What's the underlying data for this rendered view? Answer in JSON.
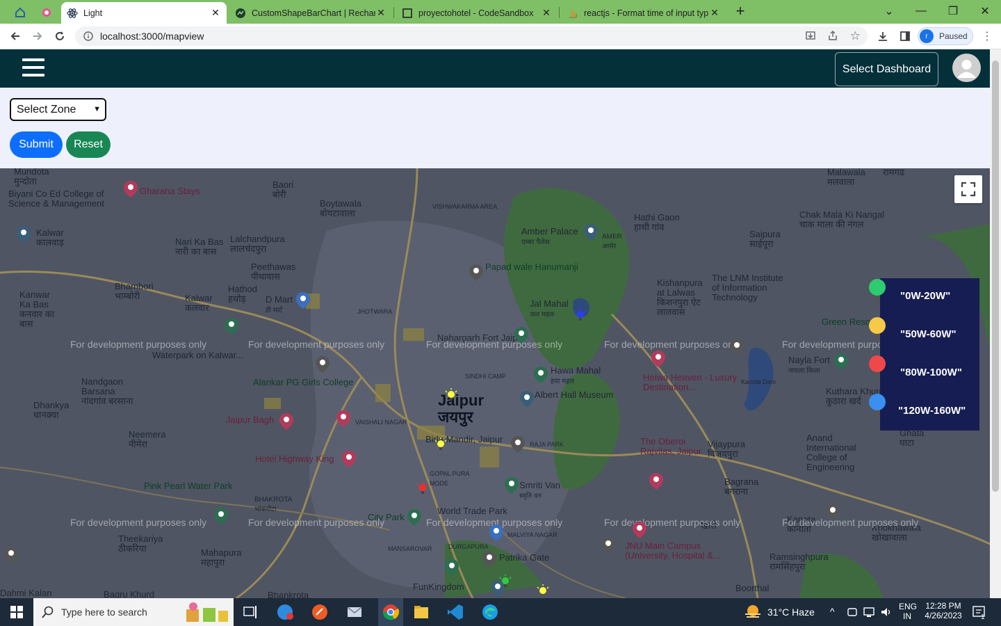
{
  "browser": {
    "tabs": [
      {
        "title": "Light",
        "active": true,
        "icon": "react-icon"
      },
      {
        "title": "CustomShapeBarChart | Recharts",
        "icon": "recharts-icon"
      },
      {
        "title": "proyectohotel - CodeSandbox",
        "icon": "codesandbox-icon"
      },
      {
        "title": "reactjs - Format time of input typ",
        "icon": "stackoverflow-icon"
      }
    ],
    "url": "localhost:3000/mapview",
    "profile_initial": "r",
    "profile_status": "Paused"
  },
  "app": {
    "dashboard_button": "Select Dashboard",
    "zone_select": {
      "selected": "Select Zone"
    },
    "submit_label": "Submit",
    "reset_label": "Reset"
  },
  "map": {
    "watermark": "For development purposes only",
    "city": {
      "en": "Jaipur",
      "hi": "जयपुर"
    },
    "places": [
      {
        "name": "Mundota",
        "local": "मुन्दोता"
      },
      {
        "name": "Biyani Co Ed College of Science & Management"
      },
      {
        "name": "Gharana Stays"
      },
      {
        "name": "Baori",
        "local": "बोरी"
      },
      {
        "name": "Boytawala",
        "local": "बोयटावाला"
      },
      {
        "name": "VISHWAKARMA AREA"
      },
      {
        "name": "Kalwar",
        "local": "कालवाड़"
      },
      {
        "name": "Nari Ka Bas",
        "local": "नारी का बास"
      },
      {
        "name": "Lalchandpura",
        "local": "लालचंदपुरा"
      },
      {
        "name": "Amber Palace",
        "local": "एम्बर पैलेस"
      },
      {
        "name": "AMER",
        "local": "आमेर"
      },
      {
        "name": "Hathi Gaon",
        "local": "हाथी गांव"
      },
      {
        "name": "Chak Mala Ki Nangal",
        "local": "चाक माला की नंगल"
      },
      {
        "name": "Saipura",
        "local": "साईपूरा"
      },
      {
        "name": "Malawala",
        "local": "मलवाला"
      },
      {
        "name": "Jamwa Ramgarh",
        "local": "रामगढ"
      },
      {
        "name": "Peethawas",
        "local": "पीथावास"
      },
      {
        "name": "Papad wale Hanumanji"
      },
      {
        "name": "Bhambori",
        "local": "भाम्बोरी"
      },
      {
        "name": "Hathod",
        "local": "हथोड़"
      },
      {
        "name": "D Mart",
        "local": "डी मार्ट"
      },
      {
        "name": "Kalwar",
        "local": "कलवार"
      },
      {
        "name": "Kanwar Ka Bas",
        "local": "कनवार का बास"
      },
      {
        "name": "Jal Mahal",
        "local": "जल महल"
      },
      {
        "name": "Kishanpura at Lalwas",
        "local": "किशनपुरा ऐट लालवास"
      },
      {
        "name": "The LNM Institute of Information Technology"
      },
      {
        "name": "Green Resort"
      },
      {
        "name": "JHOTWARA"
      },
      {
        "name": "Nahargarh Fort Jaipur"
      },
      {
        "name": "Nayla Fort",
        "local": "नायला किला"
      },
      {
        "name": "Waterpark on Kalwar..."
      },
      {
        "name": "Hawa Mahal",
        "local": "हवा महल"
      },
      {
        "name": "SINDHI CAMP"
      },
      {
        "name": "Heiwa Heaven - Luxury Destination..."
      },
      {
        "name": "Kanota Dam"
      },
      {
        "name": "Nandgaon Barsana",
        "local": "नांदगांव बरसाना"
      },
      {
        "name": "Alankar PG Girls College"
      },
      {
        "name": "Albert Hall Museum"
      },
      {
        "name": "Kuthara Khurd",
        "local": "कुठारा खर्द"
      },
      {
        "name": "Dhankya",
        "local": "धानक्या"
      },
      {
        "name": "Jaipur Bagh"
      },
      {
        "name": "VAISHALI NAGAR"
      },
      {
        "name": "Birla Mandir, Jaipur"
      },
      {
        "name": "RAJA PARK"
      },
      {
        "name": "The Oberoi Rajvilas, Jaipur"
      },
      {
        "name": "Vijaypura",
        "local": "विजयपुरा"
      },
      {
        "name": "Ghata",
        "local": "घाटा"
      },
      {
        "name": "Anand International College of Engineering"
      },
      {
        "name": "Neemera",
        "local": "नीमेरा"
      },
      {
        "name": "Hotel Highway King"
      },
      {
        "name": "GOPAL PURA MODE"
      },
      {
        "name": "Smriti Van",
        "local": "स्मृति वन"
      },
      {
        "name": "Bagrana",
        "local": "बगराना"
      },
      {
        "name": "Pink Pearl Water Park"
      },
      {
        "name": "BHAKROTA",
        "local": "भांकरोटा"
      },
      {
        "name": "World Trade Park"
      },
      {
        "name": "City Park"
      },
      {
        "name": "MALVIYA NAGAR"
      },
      {
        "name": "Kanota",
        "local": "कानोता"
      },
      {
        "name": "Khokhawala",
        "local": "खोखावाला"
      },
      {
        "name": "Theekariya",
        "local": "ठीकरिया"
      },
      {
        "name": "Mahapura",
        "local": "महापुरा"
      },
      {
        "name": "MANSAROVAR"
      },
      {
        "name": "DURGAPURA"
      },
      {
        "name": "Patrika Gate"
      },
      {
        "name": "JNU Main Campus (University, Hospital &..."
      },
      {
        "name": "Ramsinghpura",
        "local": "रामसिंहपुरा"
      },
      {
        "name": "Khori",
        "local": "खोरी"
      },
      {
        "name": "FunKingdom"
      },
      {
        "name": "Boorthal"
      },
      {
        "name": "Bhankrota"
      },
      {
        "name": "Bagru Khurd"
      },
      {
        "name": "Dahmi Kalan"
      }
    ],
    "legend": [
      {
        "label": "\"0W-20W\"",
        "color": "#2ecc71"
      },
      {
        "label": "\"50W-60W\"",
        "color": "#f7c948"
      },
      {
        "label": "\"80W-100W\"",
        "color": "#f04848"
      },
      {
        "label": "\"120W-160W\"",
        "color": "#3b8ff0"
      }
    ]
  },
  "taskbar": {
    "search_placeholder": "Type here to search",
    "weather": "31°C  Haze",
    "language": "ENG",
    "region": "IN",
    "time": "12:28 PM",
    "date": "4/26/2023",
    "notification_count": "1"
  }
}
